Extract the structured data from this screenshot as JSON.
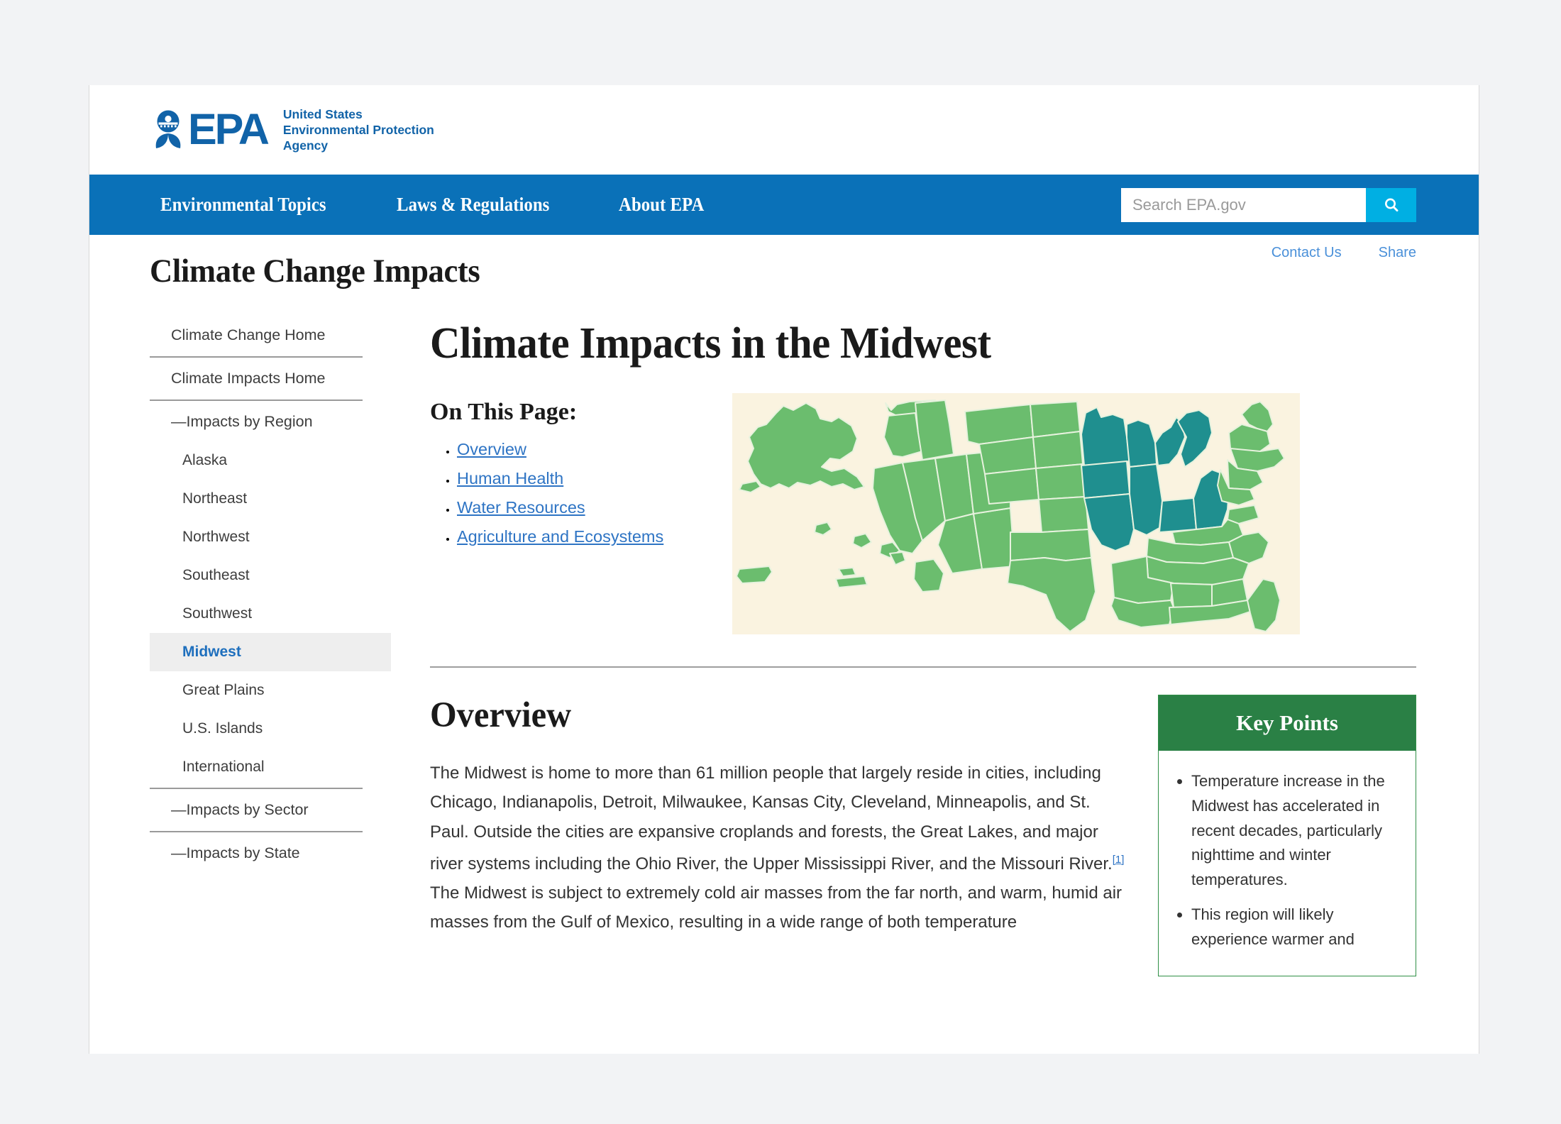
{
  "masthead": {
    "logo_word": "EPA",
    "tagline_line1": "United States",
    "tagline_line2": "Environmental Protection",
    "tagline_line3": "Agency",
    "seal_alt": "epa-seal-icon"
  },
  "nav": {
    "items": [
      {
        "label": "Environmental Topics"
      },
      {
        "label": "Laws & Regulations"
      },
      {
        "label": "About EPA"
      }
    ],
    "search_placeholder": "Search EPA.gov",
    "search_value": "",
    "search_button_icon": "search-icon"
  },
  "header": {
    "site_title": "Climate Change Impacts",
    "util_links": [
      {
        "label": "Contact Us"
      },
      {
        "label": "Share"
      }
    ]
  },
  "sidebar": {
    "items": [
      {
        "label": "Climate Change Home",
        "level": 0,
        "active": false,
        "divider_after": true
      },
      {
        "label": "Climate Impacts Home",
        "level": 0,
        "active": false,
        "divider_after": true
      },
      {
        "label": "—Impacts by Region",
        "level": 0,
        "active": false,
        "divider_after": false
      },
      {
        "label": "Alaska",
        "level": 1,
        "active": false,
        "divider_after": false
      },
      {
        "label": "Northeast",
        "level": 1,
        "active": false,
        "divider_after": false
      },
      {
        "label": "Northwest",
        "level": 1,
        "active": false,
        "divider_after": false
      },
      {
        "label": "Southeast",
        "level": 1,
        "active": false,
        "divider_after": false
      },
      {
        "label": "Southwest",
        "level": 1,
        "active": false,
        "divider_after": false
      },
      {
        "label": "Midwest",
        "level": 1,
        "active": true,
        "divider_after": false
      },
      {
        "label": "Great Plains",
        "level": 1,
        "active": false,
        "divider_after": false
      },
      {
        "label": "U.S. Islands",
        "level": 1,
        "active": false,
        "divider_after": false
      },
      {
        "label": "International",
        "level": 1,
        "active": false,
        "divider_after": true
      },
      {
        "label": "—Impacts by Sector",
        "level": 0,
        "active": false,
        "divider_after": true
      },
      {
        "label": "—Impacts by State",
        "level": 0,
        "active": false,
        "divider_after": false
      }
    ]
  },
  "main": {
    "h1": "Climate Impacts in the Midwest",
    "on_this_page": {
      "heading": "On This Page:",
      "links": [
        {
          "label": "Overview"
        },
        {
          "label": "Human Health"
        },
        {
          "label": "Water Resources"
        },
        {
          "label": "Agriculture and Ecosystems"
        }
      ]
    },
    "map": {
      "name": "us-regions-map",
      "background_color": "#faf3e0",
      "region_color": "#6bbd6e",
      "highlight_color": "#1f8f8f",
      "border_color": "#d9ecd0",
      "highlighted_region": "Midwest",
      "highlighted_states": [
        "Minnesota",
        "Iowa",
        "Missouri",
        "Wisconsin",
        "Illinois",
        "Michigan",
        "Indiana",
        "Ohio"
      ]
    },
    "overview": {
      "heading": "Overview",
      "paragraph_part1": "The Midwest is home to more than 61 million people that largely reside in cities, including Chicago, Indianapolis, Detroit, Milwaukee, Kansas City, Cleveland, Minneapolis, and St. Paul. Outside the cities are expansive croplands and forests, the Great Lakes, and major river systems including the Ohio River, the Upper Mississippi River, and the Missouri River.",
      "citation": "[1]",
      "paragraph_part2": " The Midwest is subject to extremely cold air masses from the far north, and warm, humid air masses from the Gulf of Mexico, resulting in a wide range of both temperature"
    },
    "key_points": {
      "heading": "Key Points",
      "items": [
        "Temperature increase in the Midwest has accelerated in recent decades, particularly nighttime and winter temperatures.",
        "This region will likely experience warmer and"
      ]
    }
  },
  "colors": {
    "nav_blue": "#0a71b8",
    "search_button": "#00afe3",
    "link_blue": "#2e74c4",
    "keypoints_green": "#2a8045",
    "map_teal": "#1f8f8f",
    "map_green": "#6bbd6e",
    "map_cream": "#faf3e0"
  }
}
